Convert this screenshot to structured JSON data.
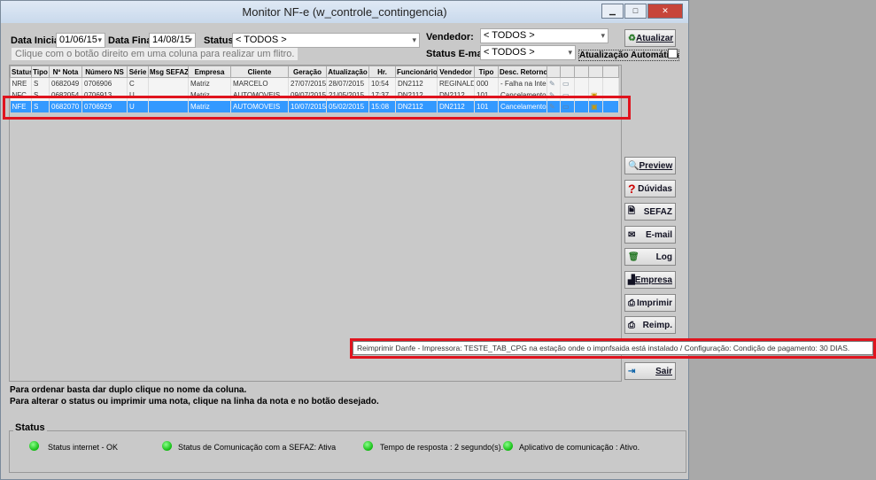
{
  "window": {
    "title": "Monitor NF-e (w_controle_contingencia)"
  },
  "filters": {
    "data_inicial_label": "Data Inicial:",
    "data_inicial": "01/06/15",
    "data_final_label": "Data Final:",
    "data_final": "14/08/15",
    "status_label": "Status:",
    "status": "< TODOS >",
    "vendedor_label": "Vendedor:",
    "vendedor": "< TODOS >",
    "status_email_label": "Status E-mail:",
    "status_email": "< TODOS >",
    "hint": "Clique com o botão direito em uma coluna para realizar um flitro.",
    "auto_update_label": "Atualização Automática",
    "auto_update_checked": false,
    "atualizar": "Atualizar"
  },
  "grid": {
    "columns": [
      "Status",
      "Tipo",
      "Nº Nota",
      "Número NS",
      "Série",
      "Msg SEFAZ",
      "Empresa",
      "Cliente",
      "Geração",
      "Atualização",
      "Hr.",
      "Funcionário",
      "Vendedor",
      "Tipo",
      "Desc. Retorno",
      "",
      "",
      "",
      "",
      ""
    ],
    "rows": [
      [
        "NRE",
        "S",
        "0682049",
        "0706906",
        "C",
        "",
        "Matriz",
        "MARCELO",
        "27/07/2015",
        "28/07/2015",
        "10:54",
        "DN2112",
        "REGINALDO",
        "000",
        "- Falha na Integ"
      ],
      [
        "NFC",
        "S",
        "0682054",
        "0706913",
        "U",
        "",
        "Matriz",
        "AUTOMOVEIS",
        "09/07/2015",
        "21/05/2015",
        "17:37",
        "DN2112",
        "DN2112",
        "101",
        "Cancelamento d"
      ],
      [
        "NFE",
        "S",
        "0682070",
        "0706929",
        "U",
        "",
        "Matriz",
        "AUTOMOVEIS",
        "10/07/2015",
        "05/02/2015",
        "15:08",
        "DN2112",
        "DN2112",
        "101",
        "Cancelamento d"
      ]
    ],
    "selected_row": 2
  },
  "buttons": {
    "preview": "Preview",
    "duvidas": "Dúvidas",
    "sefaz": "SEFAZ",
    "email": "E-mail",
    "log": "Log",
    "empresa": "Empresa",
    "imprimir": "Imprimir",
    "reimp": "Reimp.",
    "sair": "Sair"
  },
  "tooltip": "Reimprimir Danfe -  Impressora: TESTE_TAB_CPG na estação onde o impnfsaida está instalado / Configuração: Condição de pagamento: 30 DIAS.",
  "notes": [
    "Para ordenar basta dar duplo clique no nome da coluna.",
    "Para alterar o status ou imprimir uma nota, clique na linha da nota e no botão desejado."
  ],
  "status": {
    "label": "Status",
    "items": [
      "Status internet - OK",
      "Status de Comunicação com a SEFAZ: Ativa",
      "Tempo de resposta : 2 segundo(s).",
      "Aplicativo de comunicação : Ativo."
    ],
    "led_color": "#22cc22"
  },
  "highlight_color": "#e0141e"
}
